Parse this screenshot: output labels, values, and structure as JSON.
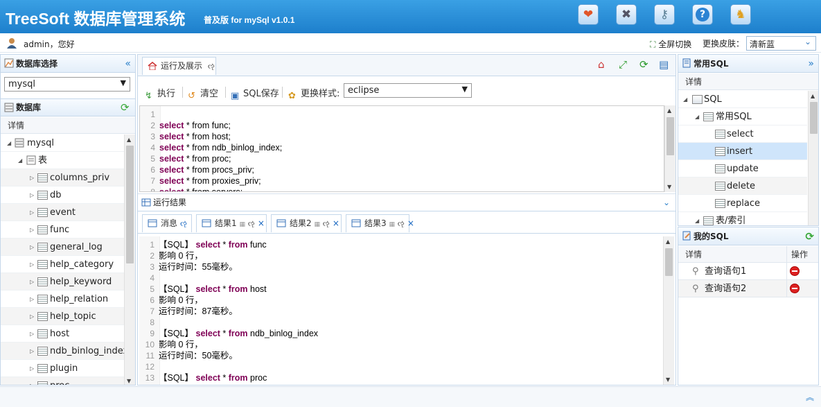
{
  "header": {
    "brand": "TreeSoft 数据库管理系统",
    "edition": "普及版 for mySql v1.0.1",
    "icons": [
      "heart-icon",
      "tools-icon",
      "key-icon",
      "help-icon",
      "logout-icon"
    ]
  },
  "userbar": {
    "greeting": "admin，您好",
    "fullscreen": "全屏切换",
    "skin_label": "更换皮肤：",
    "skin_value": "清新蓝"
  },
  "left": {
    "db_select_title": "数据库选择",
    "db_value": "mysql",
    "db_title": "数据库",
    "grid_header": "详情",
    "root": "mysql",
    "group": "表",
    "tables": [
      "columns_priv",
      "db",
      "event",
      "func",
      "general_log",
      "help_category",
      "help_keyword",
      "help_relation",
      "help_topic",
      "host",
      "ndb_binlog_index",
      "plugin",
      "proc"
    ]
  },
  "center": {
    "tab_title": "运行及展示",
    "tab_refresh": "ૡ",
    "toolbar": {
      "run": "执行",
      "clear": "清空",
      "save": "SQL保存",
      "style_label": "更换样式:",
      "style_value": "eclipse"
    },
    "editor_lines": [
      {
        "n": "1",
        "kw": "",
        "rest": ""
      },
      {
        "n": "2",
        "kw": "select",
        "rest": " * from func;"
      },
      {
        "n": "3",
        "kw": "select",
        "rest": " * from host;"
      },
      {
        "n": "4",
        "kw": "select",
        "rest": " * from ndb_binlog_index;"
      },
      {
        "n": "5",
        "kw": "select",
        "rest": " * from proc;"
      },
      {
        "n": "6",
        "kw": "select",
        "rest": " * from procs_priv;"
      },
      {
        "n": "7",
        "kw": "select",
        "rest": " * from proxies_priv;"
      },
      {
        "n": "8",
        "kw": "select",
        "rest": " * from servers;"
      }
    ],
    "result_title": "运行结果",
    "result_tabs": [
      {
        "label": "消息",
        "extra": "ૡ"
      },
      {
        "label": "结果1",
        "extra": "× "
      },
      {
        "label": "结果2",
        "extra": "×"
      },
      {
        "label": "结果3",
        "extra": "×"
      }
    ],
    "messages": [
      {
        "n": "1",
        "text": "【SQL】 ",
        "kw1": "select",
        "mid": " * ",
        "kw2": "from",
        "tail": " func"
      },
      {
        "n": "2",
        "text": "影响 0 行，"
      },
      {
        "n": "3",
        "text": "运行时间：55毫秒。"
      },
      {
        "n": "4",
        "text": ""
      },
      {
        "n": "5",
        "text": "【SQL】 ",
        "kw1": "select",
        "mid": " * ",
        "kw2": "from",
        "tail": " host"
      },
      {
        "n": "6",
        "text": "影响 0 行，"
      },
      {
        "n": "7",
        "text": "运行时间：87毫秒。"
      },
      {
        "n": "8",
        "text": ""
      },
      {
        "n": "9",
        "text": "【SQL】 ",
        "kw1": "select",
        "mid": " * ",
        "kw2": "from",
        "tail": " ndb_binlog_index"
      },
      {
        "n": "10",
        "text": "影响 0 行，"
      },
      {
        "n": "11",
        "text": "运行时间：50毫秒。"
      },
      {
        "n": "12",
        "text": ""
      },
      {
        "n": "13",
        "text": "【SQL】 ",
        "kw1": "select",
        "mid": " * ",
        "kw2": "from",
        "tail": " proc"
      }
    ]
  },
  "right": {
    "common_title": "常用SQL",
    "grid_header": "详情",
    "root": "SQL",
    "group": "常用SQL",
    "items": [
      "select",
      "insert",
      "update",
      "delete",
      "replace"
    ],
    "selected": "insert",
    "extra": "表/索引",
    "mysql_title": "我的SQL",
    "my_header": "详情",
    "my_op": "操作",
    "my_items": [
      "查询语句1",
      "查询语句2"
    ]
  }
}
